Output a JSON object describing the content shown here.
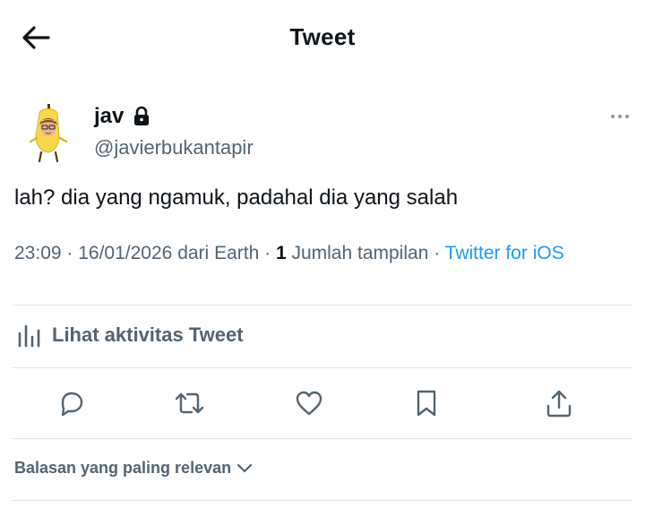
{
  "header": {
    "title": "Tweet",
    "back_icon": "arrow-left-icon"
  },
  "author": {
    "display_name": "jav",
    "handle": "@javierbukantapir",
    "avatar_icon": "banana-avatar",
    "protected_icon": "lock-icon"
  },
  "tweet": {
    "text": "lah? dia yang ngamuk, padahal dia yang salah",
    "time": "23:09",
    "date": "16/01/2026",
    "location_prefix": "dari",
    "location": "Earth",
    "views_count": "1",
    "views_label": "Jumlah tampilan",
    "source": "Twitter for iOS"
  },
  "activity": {
    "label": "Lihat aktivitas Tweet",
    "icon": "bar-chart-icon"
  },
  "actions": [
    {
      "name": "reply",
      "icon": "comment-icon"
    },
    {
      "name": "retweet",
      "icon": "retweet-icon"
    },
    {
      "name": "like",
      "icon": "heart-icon"
    },
    {
      "name": "bookmark",
      "icon": "bookmark-icon"
    },
    {
      "name": "share",
      "icon": "share-icon"
    }
  ],
  "replies_sort": {
    "label": "Balasan yang paling relevan",
    "icon": "chevron-down-icon"
  },
  "colors": {
    "text": "#0f1419",
    "secondary": "#536471",
    "accent": "#1d9bf0",
    "divider": "#dfe3e7"
  }
}
